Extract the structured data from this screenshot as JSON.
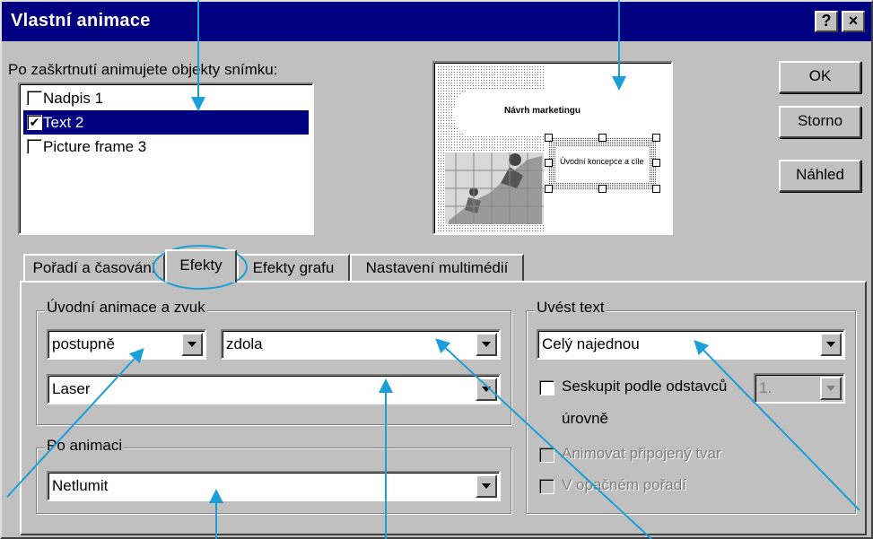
{
  "dialog": {
    "title": "Vlastní animace",
    "help_button": "?",
    "close_button": "×"
  },
  "objects": {
    "label": "Po zaškrtnutí animujete objekty snímku:",
    "items": [
      {
        "label": "Nadpis 1",
        "checked": false,
        "check_mark": ""
      },
      {
        "label": "Text 2",
        "checked": true,
        "check_mark": "✔"
      },
      {
        "label": "Picture frame 3",
        "checked": false,
        "check_mark": ""
      }
    ]
  },
  "preview": {
    "slide_title": "Návrh marketingu",
    "slide_text": "Úvodní koncepce a cíle"
  },
  "buttons": {
    "ok": "OK",
    "cancel": "Storno",
    "preview": "Náhled"
  },
  "tabs": [
    {
      "label": "Pořadí a časování",
      "active": false
    },
    {
      "label": "Efekty",
      "active": true
    },
    {
      "label": "Efekty grafu",
      "active": false
    },
    {
      "label": "Nastavení multimédií",
      "active": false
    }
  ],
  "entry_group": {
    "label": "Úvodní animace a zvuk",
    "effect": "postupně",
    "direction": "zdola",
    "sound": "Laser"
  },
  "after_group": {
    "label": "Po animaci",
    "value": "Netlumit"
  },
  "text_group": {
    "label": "Uvést text",
    "value": "Celý najednou",
    "group_by_label": "Seskupit podle odstavců",
    "group_by_level": "1.",
    "level_suffix": "úrovně",
    "animate_shape": "Animovat připojený tvar",
    "reverse_order": "V opačném pořadí"
  },
  "colors": {
    "titlebar": "#000080",
    "face": "#c0c0c0",
    "selection": "#000080",
    "callout": "#1a9fd8"
  },
  "icons": [
    "help-icon",
    "close-icon",
    "checkmark-icon",
    "dropdown-arrow-icon"
  ]
}
